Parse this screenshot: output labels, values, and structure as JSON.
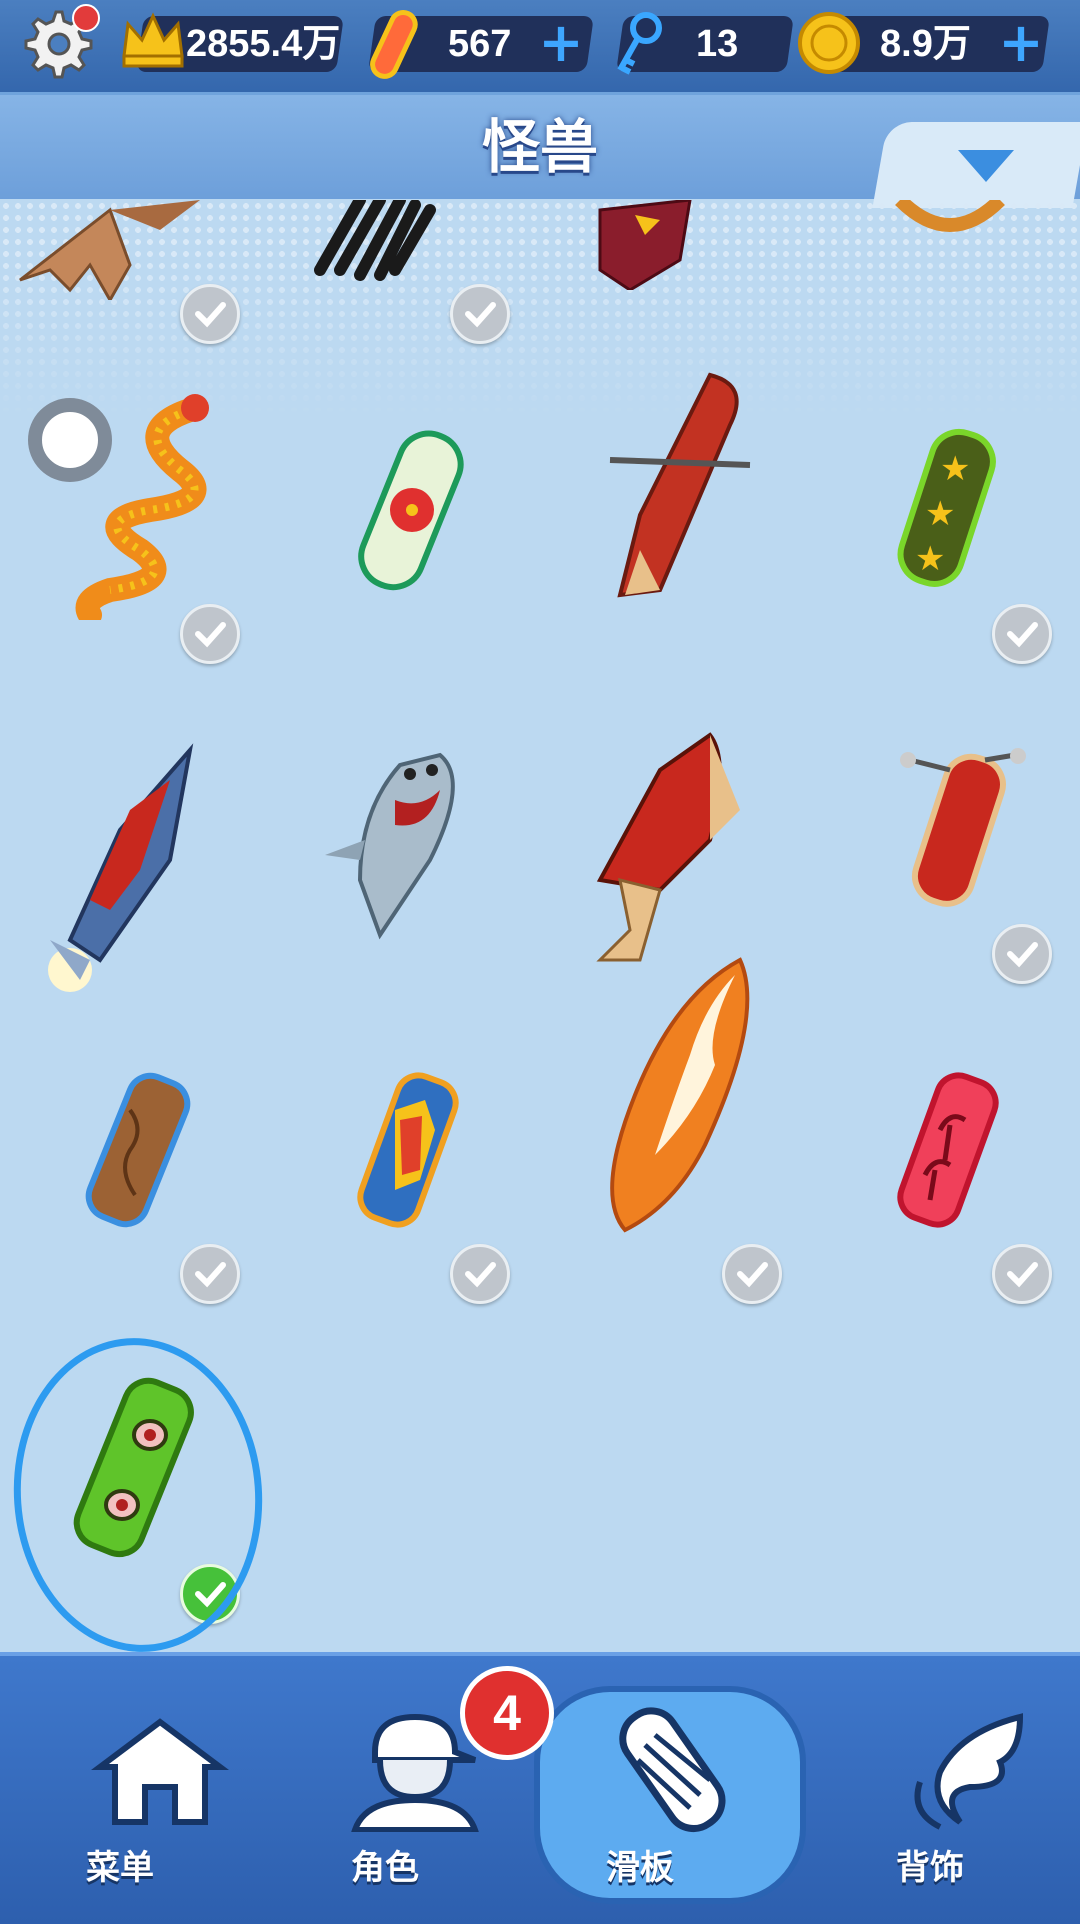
{
  "resources": {
    "crown_score": "2855.4万",
    "boards": "567",
    "keys": "13",
    "coins": "8.9万"
  },
  "title": "怪兽",
  "nav": {
    "menu": "菜单",
    "character": "角色",
    "board": "滑板",
    "accessory": "背饰",
    "character_badge": "4"
  },
  "colors": {
    "accent": "#2d9bf0",
    "owned_check": "#bfc5cc",
    "equipped_check": "#46c13a",
    "badge": "#e0302f"
  },
  "items": [
    {
      "name": "bat-wing-board",
      "owned": true
    },
    {
      "name": "black-feather-board",
      "owned": true
    },
    {
      "name": "wizard-board",
      "owned": false
    },
    {
      "name": "pretzel-board",
      "owned": false
    },
    {
      "name": "dragon-board",
      "owned": true
    },
    {
      "name": "hibiscus-board",
      "owned": false
    },
    {
      "name": "canoe-board",
      "owned": false
    },
    {
      "name": "star-board",
      "owned": true
    },
    {
      "name": "rocket-board",
      "owned": false
    },
    {
      "name": "shark-board",
      "owned": false
    },
    {
      "name": "jet-board",
      "owned": false
    },
    {
      "name": "jetpack-board",
      "owned": true
    },
    {
      "name": "wood-board",
      "owned": true
    },
    {
      "name": "bam-board",
      "owned": true
    },
    {
      "name": "surf-board",
      "owned": true
    },
    {
      "name": "palm-board",
      "owned": true
    },
    {
      "name": "monster-eyes-board",
      "owned": true,
      "equipped": true
    }
  ]
}
